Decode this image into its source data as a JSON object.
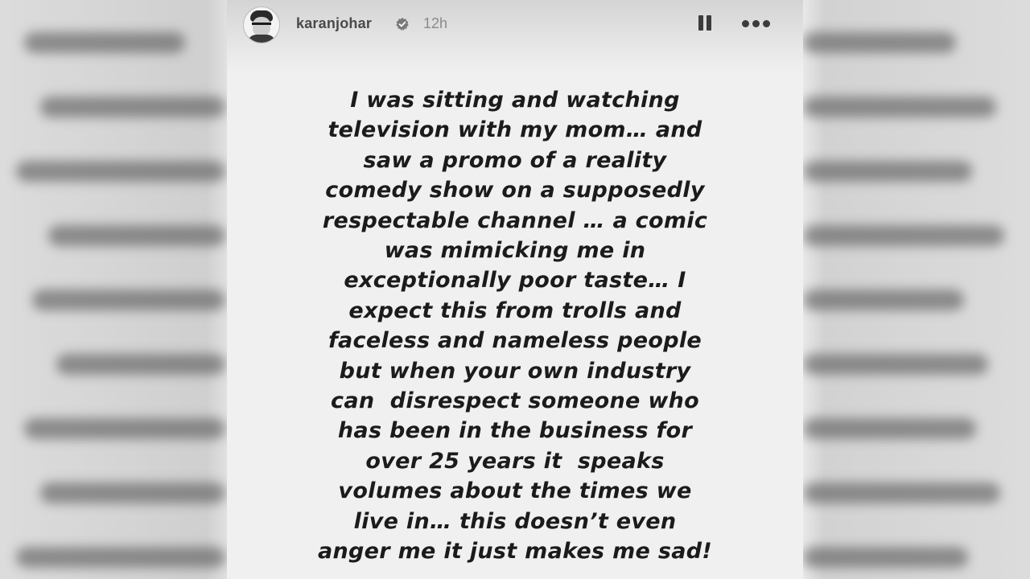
{
  "story": {
    "username": "karanjohar",
    "time_ago": "12h",
    "verified_icon": "verified-badge-icon",
    "avatar_icon": "profile-avatar",
    "pause_icon": "pause-icon",
    "more_icon": "more-options-icon",
    "lines": [
      "I was sitting and watching",
      "television with my mom… and",
      "saw a promo of a reality",
      "comedy show on a supposedly",
      "respectable channel … a comic",
      "was mimicking me in",
      "exceptionally poor taste… I",
      "expect this from trolls and",
      "faceless and nameless people",
      "but when your own industry",
      "can  disrespect someone who",
      "has been in the business for",
      "over 25 years it  speaks",
      "volumes about the times we",
      "live in… this doesn’t even",
      "anger me it just makes me sad!"
    ]
  },
  "colors": {
    "story_background": "#f0f0f0",
    "text": "#1b1b1b",
    "username": "#4a4a4a",
    "timestamp": "#8a8a8a",
    "controls": "#3c3c3c"
  }
}
